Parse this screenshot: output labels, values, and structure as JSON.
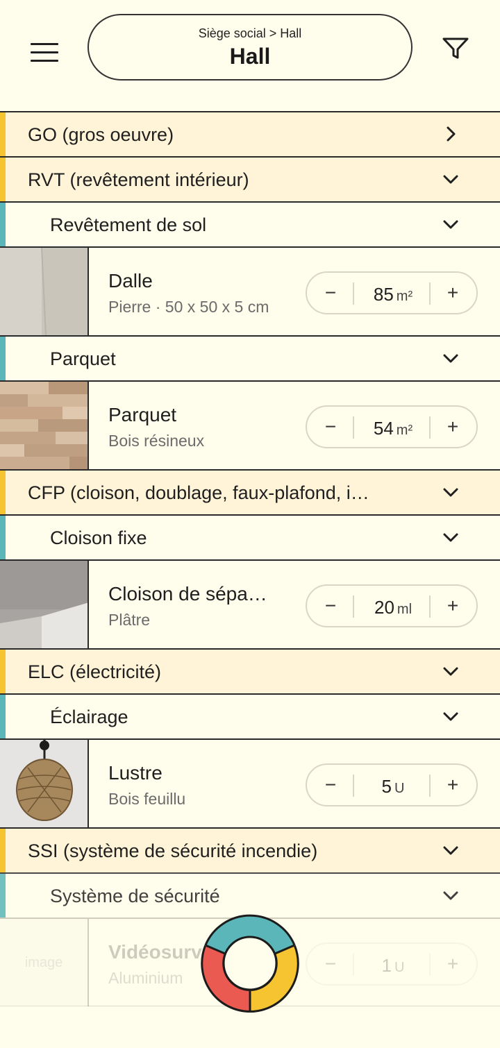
{
  "header": {
    "breadcrumb": "Siège social > Hall",
    "title": "Hall"
  },
  "rows": {
    "go": "GO (gros oeuvre)",
    "rvt": "RVT (revêtement intérieur)",
    "rvt_sol": "Revêtement de sol",
    "rvt_parquet": "Parquet",
    "cfp": "CFP (cloison, doublage, faux-plafond, i…",
    "cfp_cloison": "Cloison fixe",
    "elc": "ELC (électricité)",
    "elc_eclairage": "Éclairage",
    "ssi": "SSI (système de sécurité incendie)",
    "ssi_systeme": "Système de sécurité"
  },
  "items": {
    "dalle": {
      "name": "Dalle",
      "desc": "Pierre · 50 x 50 x 5 cm",
      "qty": "85",
      "unit": "m²"
    },
    "parquet": {
      "name": "Parquet",
      "desc": "Bois résineux",
      "qty": "54",
      "unit": "m²"
    },
    "cloison": {
      "name": "Cloison de sépa…",
      "desc": "Plâtre",
      "qty": "20",
      "unit": "ml"
    },
    "lustre": {
      "name": "Lustre",
      "desc": "Bois feuillu",
      "qty": "5",
      "unit": "U"
    },
    "video": {
      "name": "Vidéosurv",
      "desc": "Aluminium",
      "qty": "1",
      "unit": "U",
      "image_alt": "image"
    }
  },
  "stepper": {
    "minus": "−",
    "plus": "+"
  },
  "colors": {
    "background": "#fffdeb",
    "category_bar": "#f6c431",
    "subcategory_bar": "#5ab6b8",
    "ring_teal": "#5ab6b8",
    "ring_yellow": "#f6c431",
    "ring_red": "#eb5a50"
  },
  "icons": {
    "menu": "menu-icon",
    "filter": "filter-icon",
    "chevron_right": "chevron-right-icon",
    "chevron_down": "chevron-down-icon"
  }
}
